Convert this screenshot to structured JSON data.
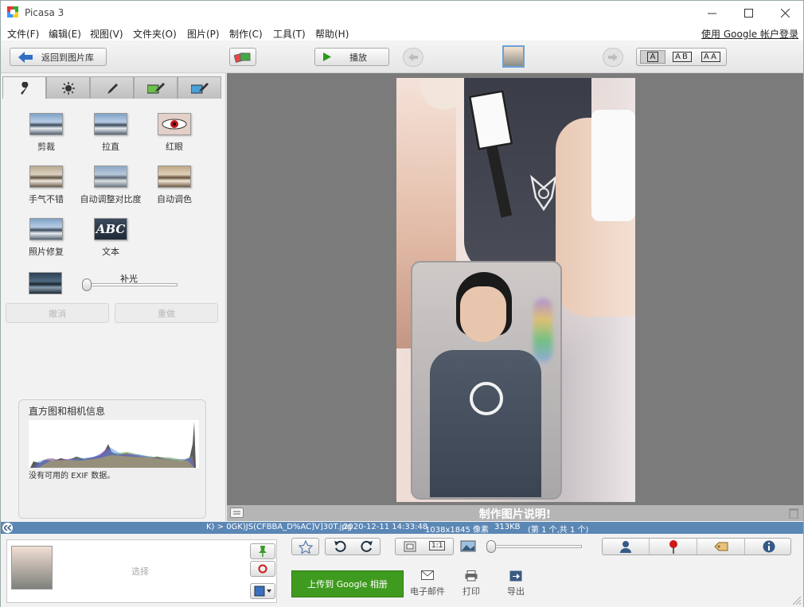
{
  "window": {
    "title": "Picasa 3"
  },
  "menu": [
    "文件(F)",
    "编辑(E)",
    "视图(V)",
    "文件夹(O)",
    "图片(P)",
    "制作(C)",
    "工具(T)",
    "帮助(H)"
  ],
  "login_link": "使用 Google 帐户登录",
  "toolbar": {
    "back_label": "返回到图片库",
    "play_label": "播放",
    "view_modes": [
      "A",
      "AB",
      "AA"
    ]
  },
  "tabs": [
    "wrench-icon",
    "sun-icon",
    "brush-icon",
    "brush-green-icon",
    "brush-blue-icon"
  ],
  "tools": [
    {
      "label": "剪裁"
    },
    {
      "label": "拉直"
    },
    {
      "label": "红眼"
    },
    {
      "label": "手气不错"
    },
    {
      "label": "自动调整对比度"
    },
    {
      "label": "自动调色"
    },
    {
      "label": "照片修复"
    },
    {
      "label": "文本"
    }
  ],
  "fill_light": {
    "label": "补光",
    "value": 0
  },
  "undo_label": "撤消",
  "redo_label": "重做",
  "histogram": {
    "title": "直方图和相机信息",
    "exif_text": "没有可用的 EXIF 数据。"
  },
  "caption_placeholder": "制作图片说明!",
  "status": {
    "path": "K) > 0GK)JS(CFBBA_D%AC]V]30T.jpg",
    "date": "2020-12-11 14:33:48",
    "dimensions": "1038x1845 像素",
    "size": "313KB",
    "position": "(第 1 个,共 1 个)"
  },
  "tray": {
    "select_label": "选择"
  },
  "upload_label": "上传到 Google 相册",
  "actions": [
    "电子邮件",
    "打印",
    "导出"
  ],
  "zoom": {
    "fit_label": "1:1"
  }
}
